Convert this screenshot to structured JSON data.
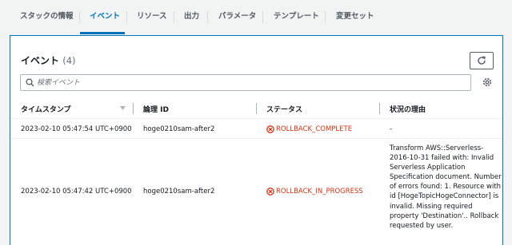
{
  "tabs": [
    {
      "label": "スタックの情報"
    },
    {
      "label": "イベント"
    },
    {
      "label": "リソース"
    },
    {
      "label": "出力"
    },
    {
      "label": "パラメータ"
    },
    {
      "label": "テンプレート"
    },
    {
      "label": "変更セット"
    }
  ],
  "active_tab": "イベント",
  "panel": {
    "title": "イベント",
    "count": "(4)",
    "search_placeholder": "検索イベント"
  },
  "table": {
    "columns": [
      "タイムスタンプ",
      "論理 ID",
      "ステータス",
      "状況の理由"
    ],
    "rows": [
      {
        "timestamp": "2023-02-10 05:47:54 UTC+0900",
        "logical_id": "hoge0210sam-after2",
        "status": "ROLLBACK_COMPLETE",
        "reason": "-"
      },
      {
        "timestamp": "2023-02-10 05:47:42 UTC+0900",
        "logical_id": "hoge0210sam-after2",
        "status": "ROLLBACK_IN_PROGRESS",
        "reason_lines": [
          "Transform AWS::Serverless-",
          "2016-10-31 failed with: Invalid",
          "Serverless Application",
          "Specification document. Number",
          "of errors found: 1. Resource with",
          "id [HogeTopicHogeConnector] is",
          "invalid. Missing required",
          "property 'Destination'.. Rollback",
          "requested by user."
        ]
      }
    ]
  },
  "colors": {
    "accent": "#0073bb",
    "error": "#d13212",
    "background": "#f2f3f3"
  },
  "icons": [
    "search-icon",
    "refresh-icon",
    "settings-icon",
    "sort-icon",
    "error-icon"
  ]
}
